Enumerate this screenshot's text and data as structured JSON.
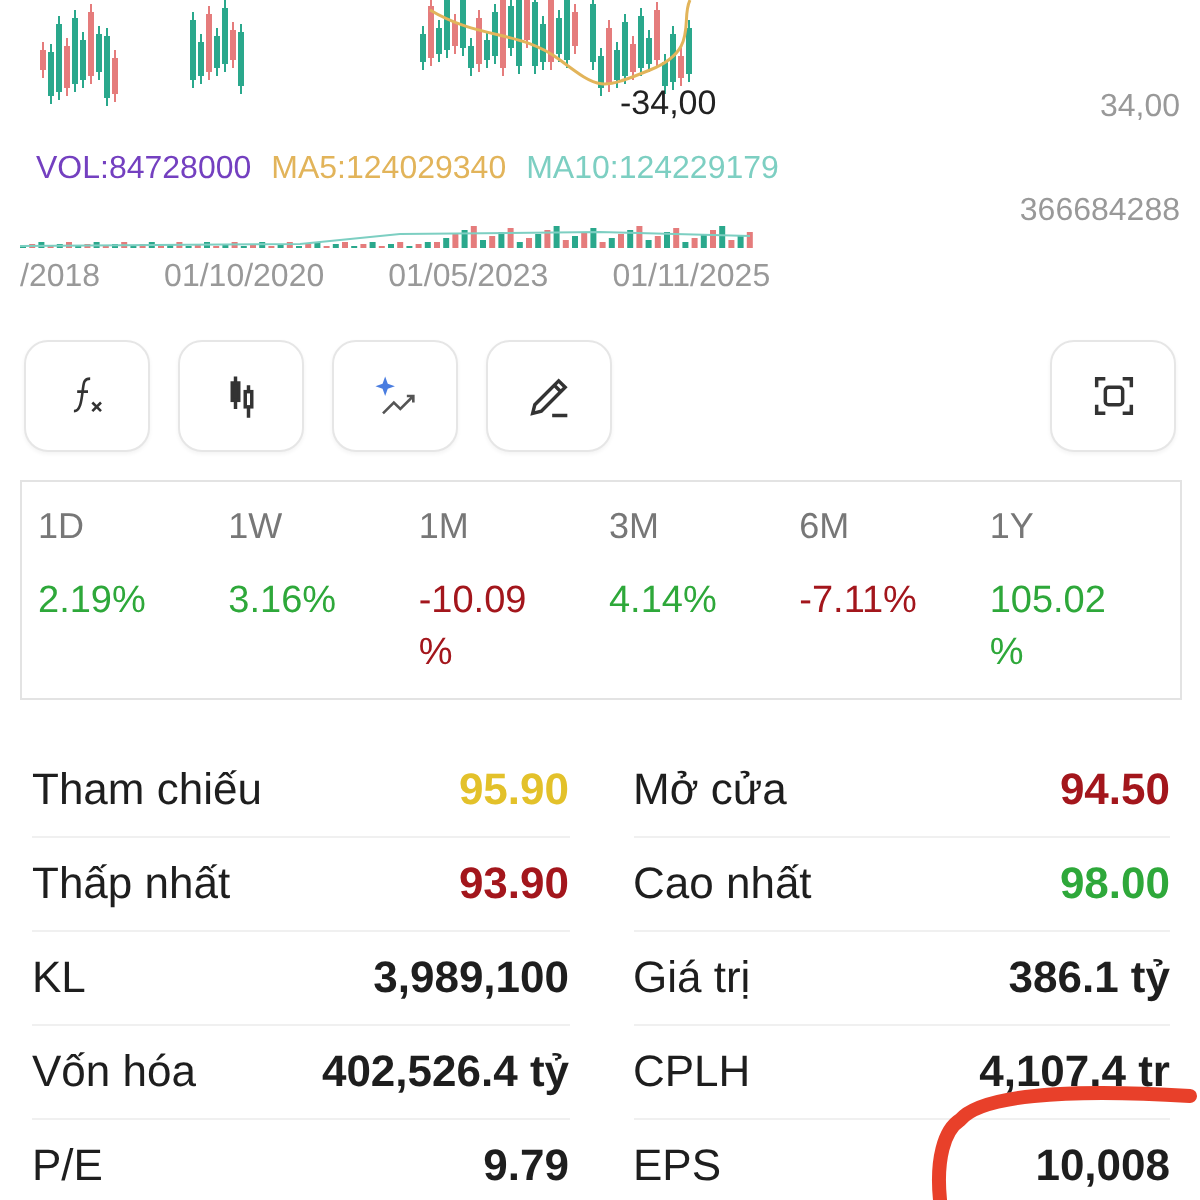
{
  "chart": {
    "price_marker": "-34,00",
    "price_axis_label": "34,00",
    "indicators": [
      {
        "label": "VOL:84728000",
        "color": "#7440c0"
      },
      {
        "label": "MA5:124029340",
        "color": "#e2b45a"
      },
      {
        "label": "MA10:124229179",
        "color": "#7dcfc2"
      }
    ],
    "volume_axis_label": "366684288",
    "dates": [
      "/2018",
      "01/10/2020",
      "01/05/2023",
      "01/11/2025"
    ]
  },
  "tools": [
    {
      "kind": "function"
    },
    {
      "kind": "candles"
    },
    {
      "kind": "ai"
    },
    {
      "kind": "draw"
    },
    {
      "kind": "fullscreen"
    }
  ],
  "periods": [
    {
      "label": "1D",
      "change": "2.19%",
      "color": "#2ea83a"
    },
    {
      "label": "1W",
      "change": "3.16%",
      "color": "#2ea83a"
    },
    {
      "label": "1M",
      "change": "-10.09 %",
      "color": "#a3161c"
    },
    {
      "label": "3M",
      "change": "4.14%",
      "color": "#2ea83a"
    },
    {
      "label": "6M",
      "change": "-7.11%",
      "color": "#a3161c"
    },
    {
      "label": "1Y",
      "change": "105.02 %",
      "color": "#2ea83a"
    }
  ],
  "stats": [
    {
      "label": "Tham chiếu",
      "value": "95.90",
      "color": "#e3c12a"
    },
    {
      "label": "Mở cửa",
      "value": "94.50",
      "color": "#a3161c"
    },
    {
      "label": "Thấp nhất",
      "value": "93.90",
      "color": "#a3161c"
    },
    {
      "label": "Cao nhất",
      "value": "98.00",
      "color": "#2ea83a"
    },
    {
      "label": "KL",
      "value": "3,989,100",
      "color": "#1e1e1e"
    },
    {
      "label": "Giá trị",
      "value": "386.1 tỷ",
      "color": "#1e1e1e"
    },
    {
      "label": "Vốn hóa",
      "value": "402,526.4 tỷ",
      "color": "#1e1e1e"
    },
    {
      "label": "CPLH",
      "value": "4,107.4 tr",
      "color": "#1e1e1e"
    },
    {
      "label": "P/E",
      "value": "9.79",
      "color": "#1e1e1e"
    },
    {
      "label": "EPS",
      "value": "10,008",
      "color": "#1e1e1e"
    }
  ]
}
